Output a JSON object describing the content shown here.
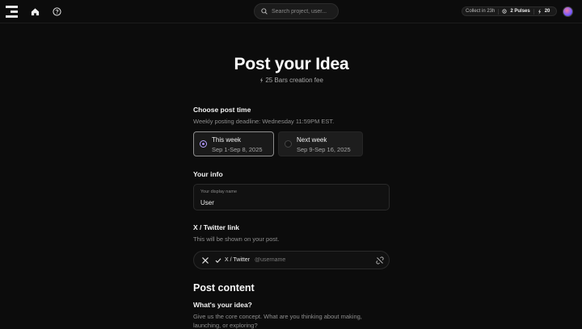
{
  "header": {
    "search_placeholder": "Search project, user...",
    "collect_label": "Collect in 23h",
    "pulses_label": "2 Pulses",
    "bars_count": "20",
    "icons": [
      "menu-logo-icon",
      "home-icon",
      "help-icon",
      "search-icon",
      "pulse-icon",
      "bars-icon",
      "avatar"
    ]
  },
  "page": {
    "title": "Post your Idea",
    "fee": "25 Bars creation fee"
  },
  "post_time": {
    "heading": "Choose post time",
    "deadline": "Weekly posting deadline: Wednesday 11:59PM EST.",
    "options": [
      {
        "label": "This week",
        "range": "Sep 1-Sep 8, 2025",
        "selected": true
      },
      {
        "label": "Next week",
        "range": "Sep 9-Sep 16, 2025",
        "selected": false
      }
    ]
  },
  "your_info": {
    "heading": "Your info",
    "display_name_label": "Your display name",
    "display_name_value": "User"
  },
  "twitter": {
    "heading": "X / Twitter link",
    "subtitle": "This will be shown on your post.",
    "tag_label": "X / Twitter",
    "placeholder": "@username"
  },
  "post_content": {
    "heading": "Post content",
    "idea_heading": "What's your idea?",
    "idea_subtitle": "Give us the core concept. What are you thinking about making,",
    "idea_subtitle_2": "launching, or exploring?"
  },
  "colors": {
    "accent": "#a98bff",
    "background": "#0c0c0c"
  }
}
